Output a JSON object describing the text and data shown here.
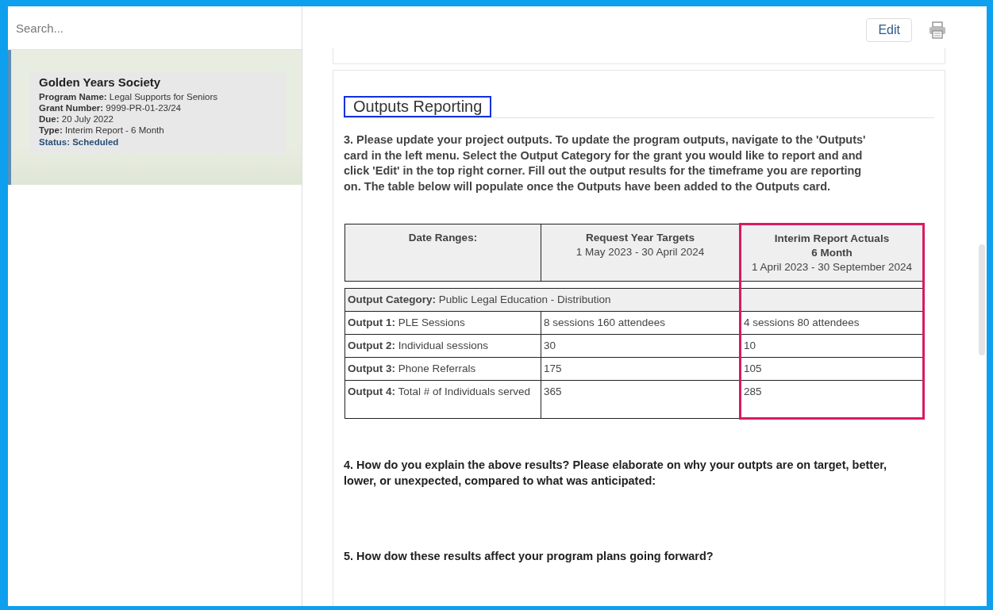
{
  "sidebar": {
    "search": {
      "placeholder": "Search..."
    },
    "items": [
      {
        "selected": true,
        "title": "Golden Years Society",
        "fields": [
          {
            "label": "Program Name:",
            "value": "Legal Supports for Seniors"
          },
          {
            "label": "Grant Number:",
            "value": "9999-PR-01-23/24"
          },
          {
            "label": "Due:",
            "value": "20 July 2022"
          },
          {
            "label": "Type:",
            "value": "Interim Report - 6 Month"
          }
        ],
        "status": "Status: Scheduled"
      }
    ]
  },
  "toolbar": {
    "edit_button": "Edit"
  },
  "section": {
    "heading": "Outputs Reporting",
    "heading_outlined": true,
    "question_3": "3. Please update your project outputs. To update the program outputs, navigate to the 'Outputs' card in the left menu. Select the Output Category for the grant you would like to report and and click 'Edit' in the top right corner. Fill out the output results for the timeframe you are reporting on. The table below will populate once the Outputs have been added to the Outputs card.",
    "table": {
      "columns": [
        {
          "title": "Date Ranges:",
          "highlighted": false
        },
        {
          "title": "Request Year Targets",
          "subtitle": "1 May 2023 - 30 April 2024",
          "highlighted": false
        },
        {
          "title": "Interim Report Actuals",
          "title_2": "6 Month",
          "subtitle": "1 April 2023 - 30 September 2024",
          "highlighted": true
        }
      ],
      "category": "**Output Category:** Public Legal Education - Distribution",
      "rows": [
        {
          "label": "**Output 1:** PLE Sessions",
          "target": "8 sessions 160 attendees",
          "actual": "4 sessions 80 attendees"
        },
        {
          "label": "**Output 2:** Individual sessions",
          "target": "30",
          "actual": "10"
        },
        {
          "label": "**Output 3:** Phone Referrals",
          "target": "175",
          "actual": "105"
        },
        {
          "label": "**Output 4:** Total # of Individuals served",
          "target": "365",
          "actual": "285"
        }
      ]
    },
    "question_4": "4. How do you explain the above results? Please elaborate on why your outpts are on target, better, lower, or unexpected, compared to what was anticipated:",
    "question_5": "5. How dow these results affect your program plans going forward?"
  }
}
